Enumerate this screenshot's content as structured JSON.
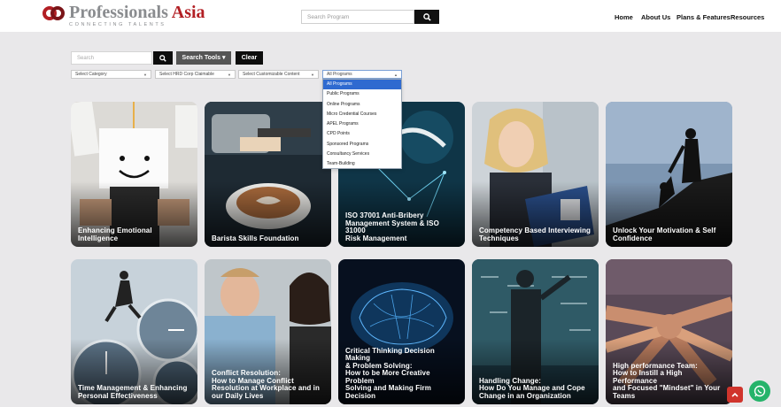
{
  "brand": {
    "name_part1": "Professionals",
    "name_part2": "Asia",
    "tagline": "CONNECTING TALENTS",
    "colors": {
      "primary": "#b21f24",
      "gray": "#8a8c8f"
    }
  },
  "header": {
    "search_placeholder": "Search Program",
    "nav": [
      "Home",
      "About Us",
      "Plans & Features",
      "Resources"
    ]
  },
  "filters": {
    "search_placeholder": "Search",
    "search_tools_label": "Search Tools",
    "clear_label": "Clear",
    "selects": [
      "Select Category",
      "Select HRD Corp Claimable",
      "Select Customizable Content",
      "All Programs"
    ],
    "program_options": [
      "All Programs",
      "Public Programs",
      "Online Programs",
      "Micro Credential Courses",
      "APEL Programs",
      "CPD Points",
      "Sponsored Programs",
      "Consultancy Services",
      "Team-Building"
    ],
    "selected_program": "All Programs"
  },
  "cards": [
    {
      "title": "Enhancing Emotional Intelligence",
      "art": "smiley-paper"
    },
    {
      "title": "Barista Skills Foundation",
      "art": "latte"
    },
    {
      "title": "ISO 37001 Anti-Bribery\nManagement System & ISO 31000\nRisk Management",
      "art": "network-hand"
    },
    {
      "title": "Competency Based Interviewing\nTechniques",
      "art": "interviewer"
    },
    {
      "title": "Unlock Your Motivation & Self\nConfidence",
      "art": "climbers"
    },
    {
      "title": "Time Management & Enhancing\nPersonal Effectiveness",
      "art": "clocks"
    },
    {
      "title": "Conflict Resolution:\nHow to Manage Conflict\nResolution at Workplace and in\nour Daily Lives",
      "art": "conflict"
    },
    {
      "title": "Critical Thinking Decision Making\n& Problem Solving:\nHow to be More Creative Problem\nSolving and Making Firm Decision",
      "art": "brain"
    },
    {
      "title": "Handling Change:\nHow Do You Manage and Cope\nChange in an Organization",
      "art": "chalkboard"
    },
    {
      "title": "High performance Team:\nHow to Instill a High Performance\nand Focused \"Mindset\" in Your\nTeams",
      "art": "hands"
    }
  ]
}
